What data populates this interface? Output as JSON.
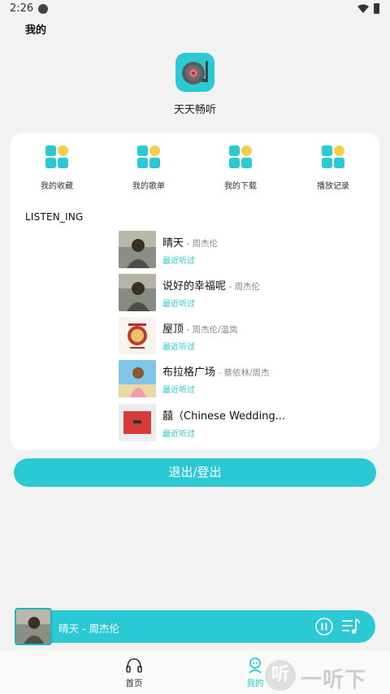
{
  "status": {
    "time": "2:26"
  },
  "page": {
    "title": "我的"
  },
  "app": {
    "name": "天天畅听"
  },
  "quick_actions": [
    {
      "label": "我的收藏",
      "icon": "grid-icon"
    },
    {
      "label": "我的歌单",
      "icon": "grid-icon"
    },
    {
      "label": "我的下载",
      "icon": "grid-icon"
    },
    {
      "label": "播放记录",
      "icon": "grid-icon"
    }
  ],
  "listening": {
    "title": "LISTEN_ING",
    "songs": [
      {
        "title": "晴天",
        "artist": " - 周杰伦",
        "tag": "最近听过"
      },
      {
        "title": "说好的幸福呢",
        "artist": " - 周杰伦",
        "tag": "最近听过"
      },
      {
        "title": "屋顶",
        "artist": " - 周杰伦/温岚",
        "tag": "最近听过"
      },
      {
        "title": "布拉格广场",
        "artist": " - 蔡依林/周杰",
        "tag": "最近听过"
      },
      {
        "title": "囍（Chinese Wedding...",
        "artist": "",
        "tag": "最近听过"
      }
    ]
  },
  "logout": {
    "label": "退出/登出"
  },
  "player": {
    "now_playing": "晴天 - 周杰伦"
  },
  "nav": [
    {
      "label": "首页",
      "active": false
    },
    {
      "label": "我的",
      "active": true
    }
  ],
  "watermark": {
    "badge": "听",
    "text": "一听下载"
  },
  "colors": {
    "accent": "#2bc9d4",
    "tile_accent": "#f2cf4a",
    "background": "#f2f2f2"
  }
}
